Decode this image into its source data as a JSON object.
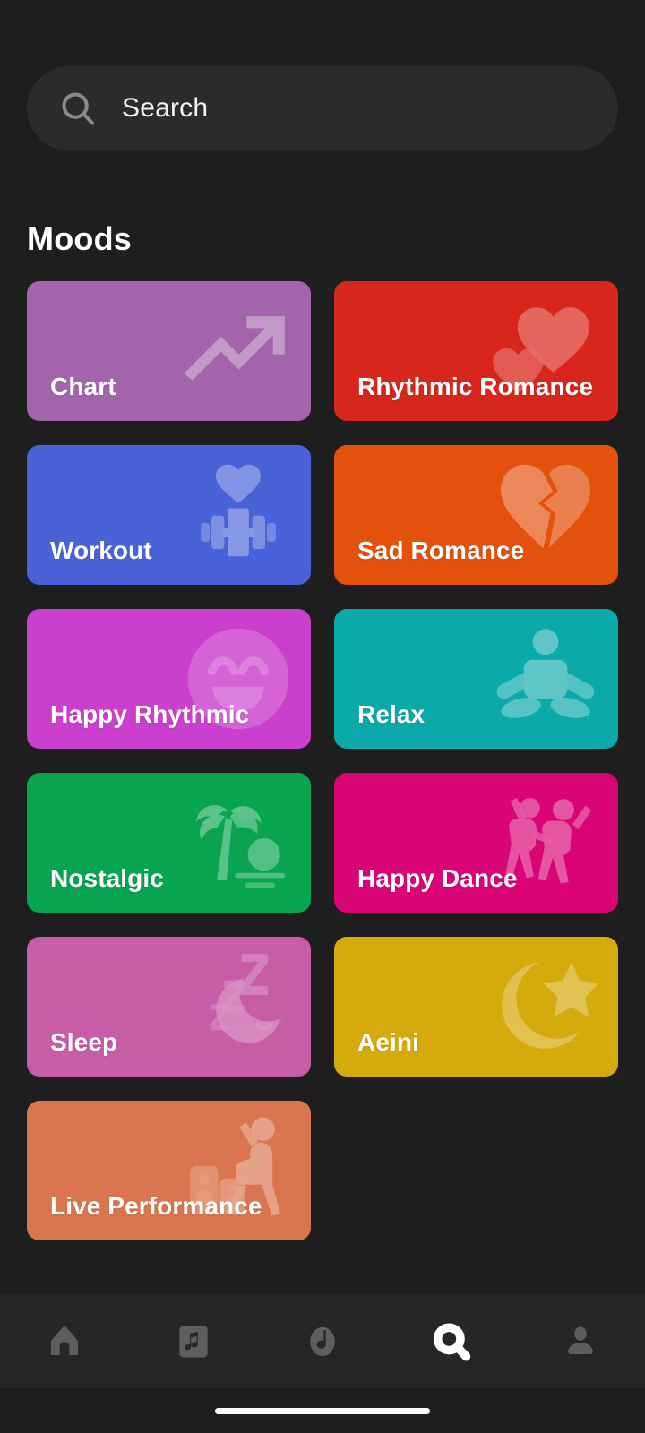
{
  "search": {
    "placeholder": "Search",
    "icon": "search-icon"
  },
  "section": {
    "title": "Moods"
  },
  "theme": {
    "page_background": "#1e1e1e",
    "search_background": "#2b2b2b",
    "nav_background": "#262626",
    "nav_icon_inactive": "#5e5e5e",
    "nav_icon_active": "#ffffff",
    "card_label_color": "#ffffff"
  },
  "moods": [
    {
      "label": "Chart",
      "color": "#a464ab",
      "icon": "trending-up-icon"
    },
    {
      "label": "Rhythmic Romance",
      "color": "#d9261c",
      "icon": "double-heart-icon"
    },
    {
      "label": "Workout",
      "color": "#4a62d8",
      "icon": "dumbbell-heart-icon"
    },
    {
      "label": "Sad Romance",
      "color": "#e2520d",
      "icon": "broken-heart-icon"
    },
    {
      "label": "Happy Rhythmic",
      "color": "#cb3fce",
      "icon": "smiley-face-icon"
    },
    {
      "label": "Relax",
      "color": "#0ca9ab",
      "icon": "meditation-icon"
    },
    {
      "label": "Nostalgic",
      "color": "#08a450",
      "icon": "palm-beach-icon"
    },
    {
      "label": "Happy Dance",
      "color": "#d90576",
      "icon": "dancing-people-icon"
    },
    {
      "label": "Sleep",
      "color": "#c75da7",
      "icon": "sleeping-moon-icon"
    },
    {
      "label": "Aeini",
      "color": "#d4aa0d",
      "icon": "crescent-star-icon"
    },
    {
      "label": "Live Performance",
      "color": "#d9764f",
      "icon": "performer-speakers-icon"
    }
  ],
  "bottom_nav": {
    "items": [
      {
        "name": "home",
        "icon": "home-icon",
        "active": false
      },
      {
        "name": "library",
        "icon": "music-note-card-icon",
        "active": false
      },
      {
        "name": "discover",
        "icon": "vinyl-note-icon",
        "active": false
      },
      {
        "name": "search",
        "icon": "search-icon",
        "active": true
      },
      {
        "name": "profile",
        "icon": "person-icon",
        "active": false
      }
    ]
  }
}
